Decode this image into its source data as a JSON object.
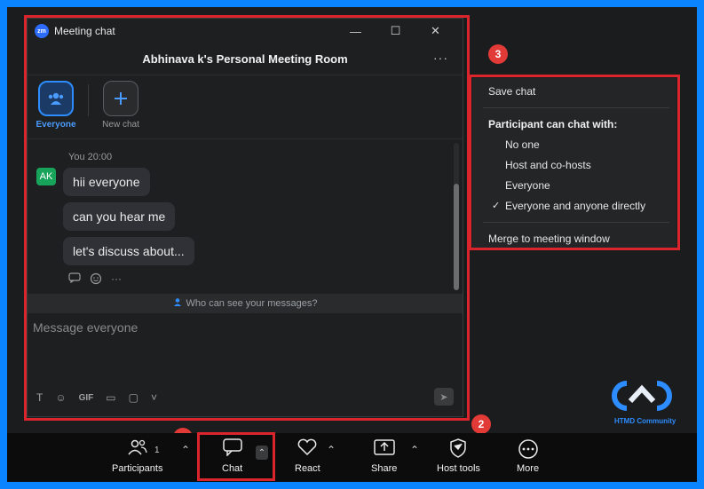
{
  "window": {
    "logo": "zm",
    "title": "Meeting chat",
    "controls": {
      "minimize": "—",
      "maximize": "☐",
      "close": "✕"
    }
  },
  "room": {
    "title": "Abhinava k's Personal Meeting Room",
    "more": "···"
  },
  "recipients": {
    "everyone": {
      "label": "Everyone",
      "icon": "people-icon"
    },
    "new_chat": {
      "label": "New chat",
      "icon": "plus-icon"
    }
  },
  "messages": {
    "avatar": "AK",
    "sender": "You",
    "time": "20:00",
    "items": [
      "hii everyone",
      "can you hear me",
      "let's discuss about..."
    ]
  },
  "visibility_hint": "Who can see your messages?",
  "compose": {
    "placeholder": "Message everyone",
    "tools": [
      "T",
      "☺",
      "GIF",
      "▭",
      "▢",
      "˅"
    ],
    "send": "➤"
  },
  "menu": {
    "save_chat": "Save chat",
    "heading": "Participant can chat with:",
    "options": [
      "No one",
      "Host and co-hosts",
      "Everyone",
      "Everyone and anyone directly"
    ],
    "selected_index": 3,
    "check": "✓",
    "merge": "Merge to meeting window"
  },
  "badges": {
    "one": "1",
    "two": "2",
    "three": "3"
  },
  "toolbar": {
    "participants": {
      "label": "Participants",
      "count": "1",
      "icon": "participants-icon"
    },
    "chat": {
      "label": "Chat",
      "icon": "chat-icon"
    },
    "react": {
      "label": "React",
      "icon": "heart-icon"
    },
    "share": {
      "label": "Share",
      "icon": "share-icon"
    },
    "host_tools": {
      "label": "Host tools",
      "icon": "shield-icon"
    },
    "more": {
      "label": "More",
      "icon": "more-icon"
    },
    "caret": "⌃"
  },
  "logo_text": "HTMD Community",
  "colors": {
    "accent": "#2d8cff",
    "highlight": "#d9252b",
    "badge": "#e23a36",
    "frame": "#0a84ff"
  }
}
